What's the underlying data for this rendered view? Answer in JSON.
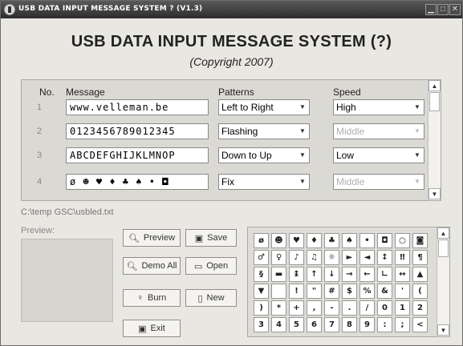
{
  "window": {
    "title": "USB DATA INPUT MESSAGE SYSTEM ? (V1.3)",
    "buttons": [
      "minimize",
      "maximize",
      "close"
    ]
  },
  "header": {
    "title": "USB DATA INPUT MESSAGE SYSTEM (?)",
    "copyright": "(Copyright 2007)"
  },
  "table": {
    "col_no": "No.",
    "col_message": "Message",
    "col_patterns": "Patterns",
    "col_speed": "Speed",
    "rows": [
      {
        "no": "1",
        "message": "www.velleman.be",
        "pattern": "Left to Right",
        "speed": "High",
        "speed_enabled": true
      },
      {
        "no": "2",
        "message": "0123456789012345",
        "pattern": "Flashing",
        "speed": "Middle",
        "speed_enabled": false
      },
      {
        "no": "3",
        "message": "ABCDEFGHIJKLMNOP",
        "pattern": "Down to Up",
        "speed": "Low",
        "speed_enabled": true
      },
      {
        "no": "4",
        "message": "ø ☻ ♥ ♦ ♣ ♠ • ◘",
        "pattern": "Fix",
        "speed": "Middle",
        "speed_enabled": false
      }
    ]
  },
  "file_path": "C:\\temp GSC\\usbled.txt",
  "preview_label": "Preview:",
  "buttons": {
    "preview": "Preview",
    "save": "Save",
    "demo_all": "Demo All",
    "open": "Open",
    "burn": "Burn",
    "new": "New",
    "exit": "Exit"
  },
  "charmap": {
    "rows": [
      [
        "ø",
        "☻",
        "♥",
        "♦",
        "♣",
        "♠",
        "•",
        "◘",
        "○",
        "◙"
      ],
      [
        "♂",
        "♀",
        "♪",
        "♫",
        "☼",
        "►",
        "◄",
        "↕",
        "‼",
        "¶"
      ],
      [
        "§",
        "▬",
        "↨",
        "↑",
        "↓",
        "→",
        "←",
        "∟",
        "↔",
        "▲"
      ],
      [
        "▼",
        "",
        "!",
        "\"",
        "#",
        "$",
        "%",
        "&",
        "'",
        "("
      ],
      [
        ")",
        "*",
        "+",
        ",",
        "-",
        ".",
        "/",
        "0",
        "1",
        "2"
      ],
      [
        "3",
        "4",
        "5",
        "6",
        "7",
        "8",
        "9",
        ":",
        ";",
        "<"
      ]
    ]
  }
}
